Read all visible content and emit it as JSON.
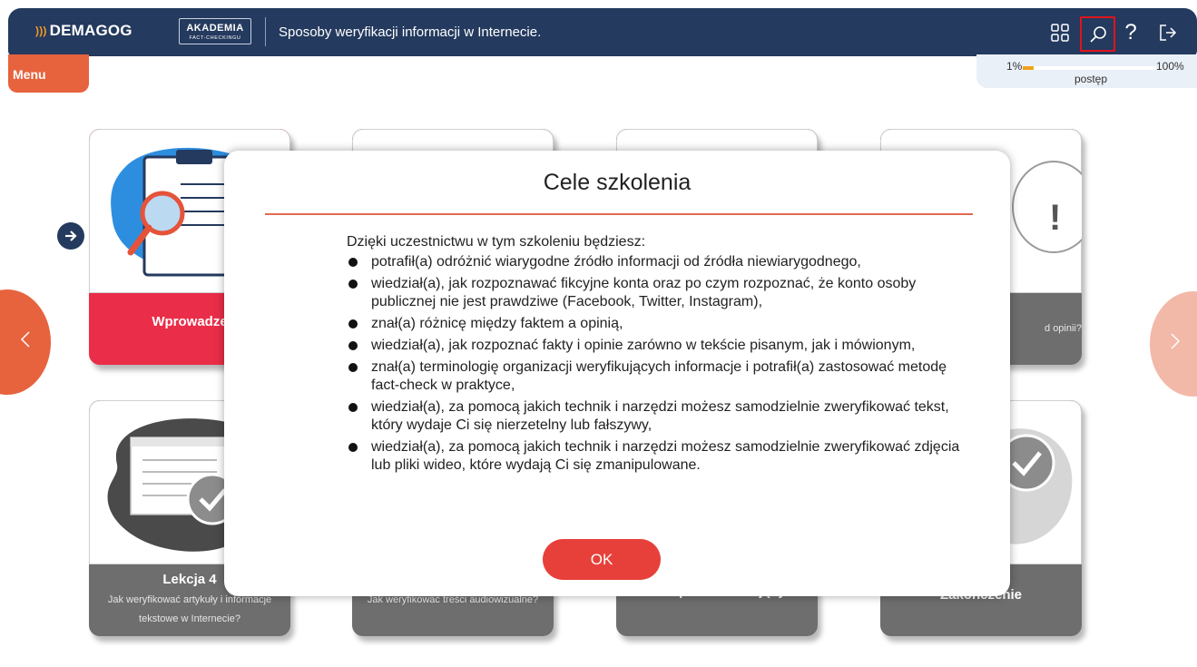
{
  "header": {
    "brand": "DEMAGOG",
    "brand_waves": ")))",
    "akademia": "AKADEMIA",
    "akademia_sub": "FACT-CHECKINGU",
    "title": "Sposoby weryfikacji informacji w Internecie.",
    "icons": [
      "grid-icon",
      "search-icon",
      "help-icon",
      "exit-icon"
    ],
    "help_glyph": "?"
  },
  "menu": {
    "label": "Menu"
  },
  "progress": {
    "min_label": "1%",
    "max_label": "100%",
    "label": "postęp",
    "value": 0.01
  },
  "cards": [
    {
      "title": "Wprowadze",
      "subtitle": ""
    },
    {
      "title": "",
      "subtitle": ""
    },
    {
      "title": "",
      "subtitle": ""
    },
    {
      "title": "",
      "subtitle": "d opinii?"
    },
    {
      "title": "Lekcja 4",
      "subtitle": "Jak weryfikować artykuły i informacje tekstowe w Internecie?"
    },
    {
      "title": "",
      "subtitle": "Jak weryfikować treści audiowizualne?"
    },
    {
      "title": "Test podsumowujący",
      "subtitle": ""
    },
    {
      "title": "Zakończenie",
      "subtitle": ""
    }
  ],
  "modal": {
    "title": "Cele szkolenia",
    "intro": "Dzięki uczestnictwu w tym szkoleniu będziesz:",
    "items": [
      "potrafił(a) odróżnić wiarygodne źródło informacji od źródła niewiarygodnego,",
      "wiedział(a), jak rozpoznawać fikcyjne konta oraz po czym rozpoznać, że konto osoby publicznej nie jest prawdziwe (Facebook, Twitter, Instagram),",
      "znał(a) różnicę między faktem a opinią,",
      "wiedział(a), jak rozpoznać fakty i opinie zarówno w tekście pisanym, jak i mówionym,",
      "znał(a) terminologię organizacji weryfikujących informacje i potrafił(a) zastosować metodę fact-check w praktyce,",
      "wiedział(a), za pomocą jakich technik i narzędzi możesz samodzielnie zweryfikować tekst, który wydaje Ci się nierzetelny lub fałszywy,",
      "wiedział(a), za pomocą jakich technik i narzędzi możesz samodzielnie zweryfikować zdjęcia lub pliki wideo, które wydają Ci się zmanipulowane."
    ],
    "ok_label": "OK"
  },
  "colors": {
    "header": "#243a5e",
    "accent": "#e7633e",
    "active_card": "#ea2d48",
    "card": "#6e6e6e",
    "progress": "#f1a21a"
  }
}
